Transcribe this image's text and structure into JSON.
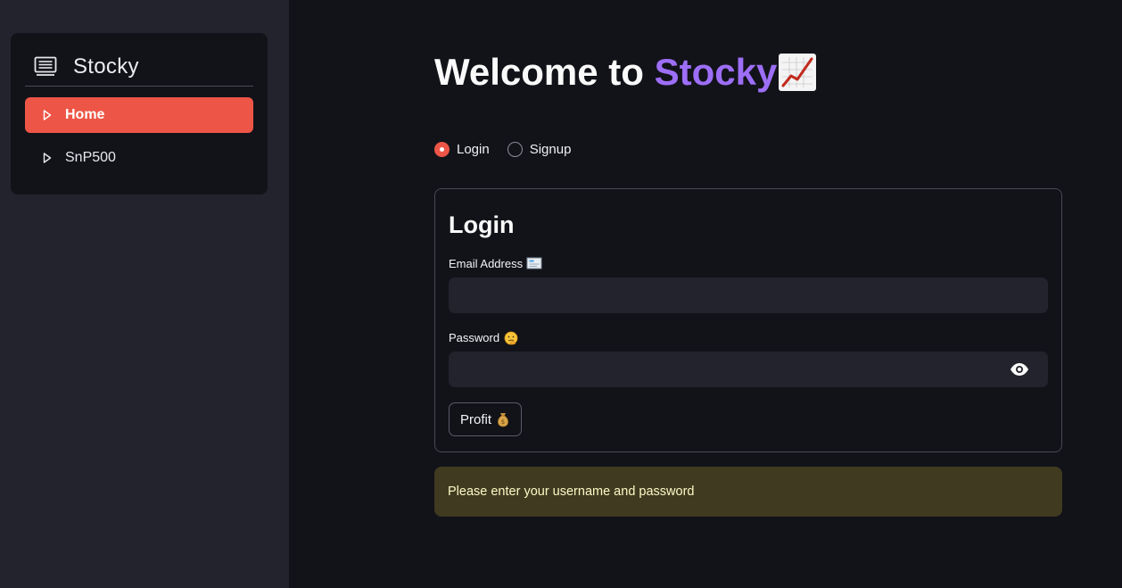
{
  "sidebar": {
    "app_name": "Stocky",
    "app_icon": "menu-card-icon",
    "items": [
      {
        "label": "Home",
        "icon": "caret-right-icon",
        "active": true
      },
      {
        "label": "SnP500",
        "icon": "caret-right-icon",
        "active": false
      }
    ]
  },
  "main": {
    "welcome_prefix": "Welcome to ",
    "welcome_brand": "Stocky",
    "welcome_emoji": "chart-increasing-emoji",
    "mode": {
      "options": [
        {
          "label": "Login",
          "selected": true
        },
        {
          "label": "Signup",
          "selected": false
        }
      ]
    },
    "login_form": {
      "title": "Login",
      "email_label": "Email Address",
      "email_emoji": "envelope-emoji",
      "email_value": "",
      "password_label": "Password",
      "password_emoji": "thinking-face-emoji",
      "password_value": "",
      "submit_label": "Profit",
      "submit_emoji": "money-bag-emoji"
    },
    "alert": {
      "text": "Please enter your username and password"
    }
  },
  "colors": {
    "accent": "#ed5547",
    "brand": "#9d6ef7",
    "sidebar_bg": "#23232d",
    "page_bg": "#121319",
    "warning_bg": "#3f3a20",
    "warning_text": "#fff8c4"
  }
}
